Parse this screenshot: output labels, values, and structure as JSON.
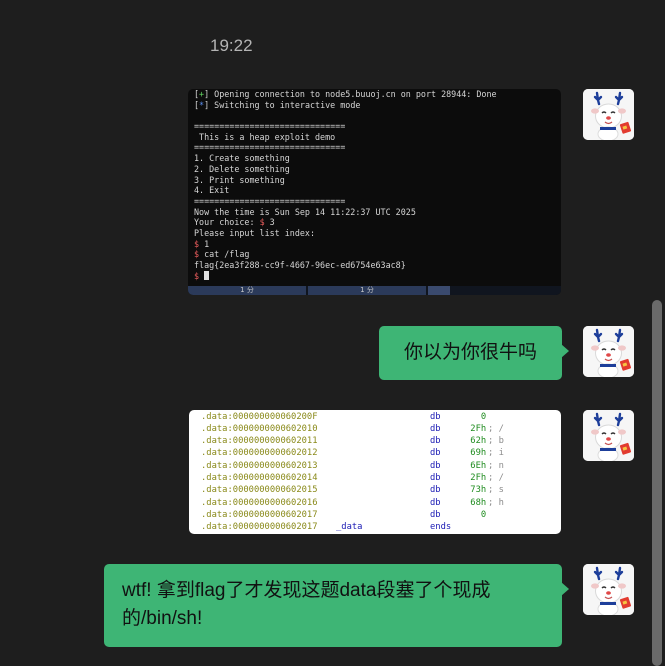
{
  "chat": {
    "timestamp": "19:22",
    "terminal": {
      "lines": [
        {
          "prefix": "[",
          "mark": "+",
          "mark_color": "green",
          "post": "]",
          "text": " Opening connection to node5.buuoj.cn on port 28944: Done"
        },
        {
          "prefix": "[",
          "mark": "*",
          "mark_color": "blue",
          "post": "]",
          "text": " Switching to interactive mode"
        },
        {
          "text": ""
        },
        {
          "text": "=============================="
        },
        {
          "text": " This is a heap exploit demo"
        },
        {
          "text": "=============================="
        },
        {
          "text": "1. Create something"
        },
        {
          "text": "2. Delete something"
        },
        {
          "text": "3. Print something"
        },
        {
          "text": "4. Exit"
        },
        {
          "text": "=============================="
        },
        {
          "text": "Now the time is Sun Sep 14 11:22:37 UTC 2025"
        },
        {
          "text": "Your choice: ",
          "mark": "$",
          "mark_color": "red",
          "post": " 3"
        },
        {
          "text": "Please input list index:"
        },
        {
          "mark": "$",
          "mark_color": "red",
          "text": " 1"
        },
        {
          "mark": "$",
          "mark_color": "red",
          "text": " cat /flag"
        },
        {
          "text": "flag{2ea3f288-cc9f-4667-96ec-ed6754e63ac8}"
        },
        {
          "mark": "$",
          "mark_color": "red",
          "text": " ",
          "cursor": true
        }
      ],
      "taskbar": [
        "1 分",
        "1 分"
      ]
    },
    "message_1": "你以为你很牛吗",
    "ida_rows": [
      {
        "addr": ".data:000000000060200F",
        "label": "",
        "op": "db",
        "val": "   0",
        "cmt": ""
      },
      {
        "addr": ".data:0000000000602010",
        "label": "",
        "op": "db",
        "val": " 2Fh",
        "cmt": "; /"
      },
      {
        "addr": ".data:0000000000602011",
        "label": "",
        "op": "db",
        "val": " 62h",
        "cmt": "; b"
      },
      {
        "addr": ".data:0000000000602012",
        "label": "",
        "op": "db",
        "val": " 69h",
        "cmt": "; i"
      },
      {
        "addr": ".data:0000000000602013",
        "label": "",
        "op": "db",
        "val": " 6Eh",
        "cmt": "; n"
      },
      {
        "addr": ".data:0000000000602014",
        "label": "",
        "op": "db",
        "val": " 2Fh",
        "cmt": "; /"
      },
      {
        "addr": ".data:0000000000602015",
        "label": "",
        "op": "db",
        "val": " 73h",
        "cmt": "; s"
      },
      {
        "addr": ".data:0000000000602016",
        "label": "",
        "op": "db",
        "val": " 68h",
        "cmt": "; h"
      },
      {
        "addr": ".data:0000000000602017",
        "label": "",
        "op": "db",
        "val": "   0",
        "cmt": ""
      },
      {
        "addr": ".data:0000000000602017",
        "label": "_data",
        "op": "ends",
        "val": "",
        "cmt": ""
      }
    ],
    "message_2": "wtf! 拿到flag了才发现这题data段塞了个现成的/bin/sh!"
  },
  "colors": {
    "background": "#1e1e1e",
    "bubble": "#3eb575",
    "terminal_bg": "#0c0c0c"
  },
  "icons": {
    "avatar": "reindeer-mascot-avatar"
  }
}
